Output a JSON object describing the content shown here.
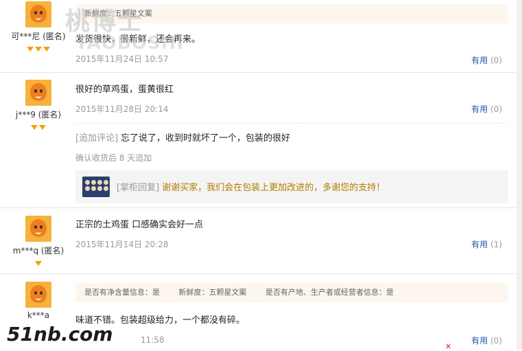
{
  "useful_label": "有用",
  "reviews": [
    {
      "user": "可***尼 (匿名)",
      "tags": [
        "新鲜度：五颗星文案"
      ],
      "text": "发货很快，很新鲜，还会再来。",
      "date": "2015年11月24日 10:57",
      "useful_count": "(0)",
      "gems": 3
    },
    {
      "user": "j***9 (匿名)",
      "text": "很好的草鸡蛋，蛋黄很红",
      "date": "2015年11月28日 20:14",
      "useful_count": "(0)",
      "gems": 2,
      "append": {
        "label": "[追加评论]",
        "text": "忘了说了，收到时就坏了一个，包装的很好",
        "meta": "确认收货后 8 天追加"
      },
      "reply": {
        "label": "[掌柜回复]",
        "text": "谢谢买家，我们会在包装上更加改进的，多谢您的支持！"
      }
    },
    {
      "user": "m***q (匿名)",
      "text": "正宗的土鸡蛋 口感确实会好一点",
      "date": "2015年11月14日 20:28",
      "useful_count": "(1)",
      "gems": 1
    },
    {
      "user": "k***a",
      "tags": [
        "是否有净含量信息：是",
        "新鲜度：五颗星文案",
        "是否有产地、生产者或经营者信息：是"
      ],
      "text": "味道不错。包装超级给力，一个都没有碎。",
      "date": "11:58",
      "useful_count": "(0)"
    }
  ],
  "watermarks": {
    "top": "桃博士",
    "top_sub": "TAOBOSHI",
    "bottom": "51nb.com"
  },
  "colors": {
    "link": "#1a5aa8",
    "reply": "#b07d00",
    "gem": "#f2a100",
    "tag_bg": "#fdf6ef"
  }
}
